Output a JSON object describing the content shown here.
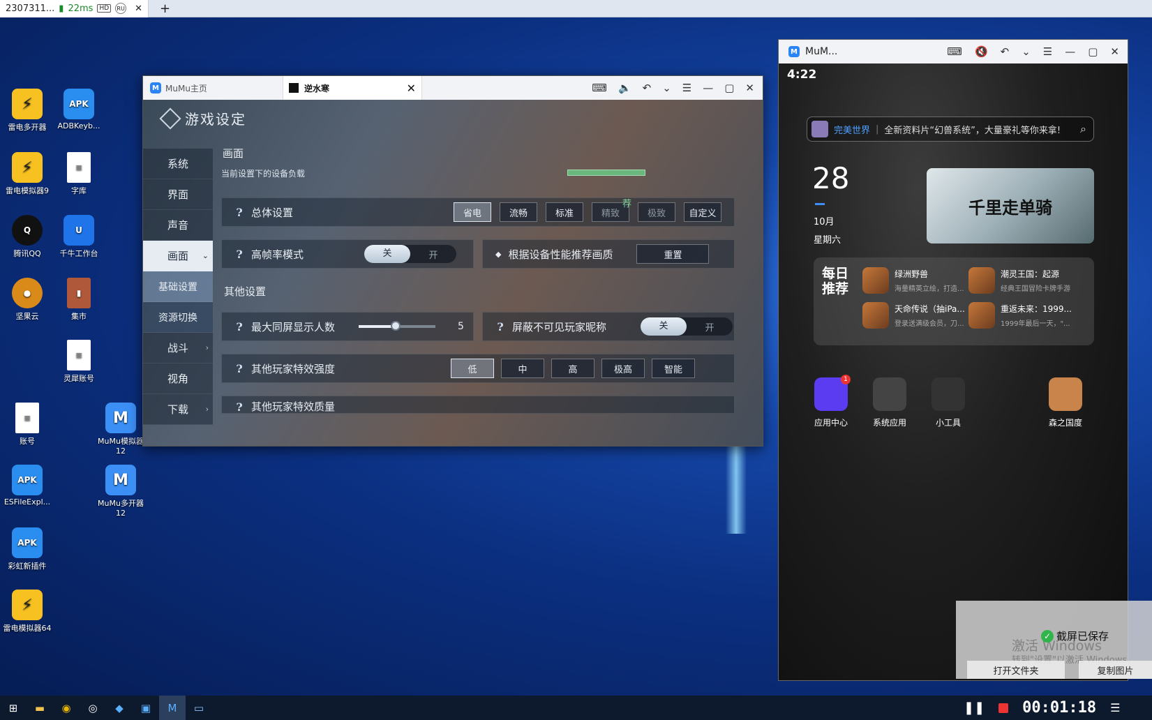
{
  "browser_bar": {
    "tab_title": "2307311...",
    "latency": "22ms",
    "hd_badge": "HD",
    "ru_badge": "RU",
    "close": "✕",
    "new_tab": "+"
  },
  "desktop_icons": [
    {
      "label": "雷电多开器",
      "glyph": "⚡",
      "kind": "ld"
    },
    {
      "label": "ADBKeyb...",
      "glyph": "APK",
      "kind": "apk"
    },
    {
      "label": "雷电模拟器9",
      "glyph": "⚡",
      "kind": "ld"
    },
    {
      "label": "字库",
      "glyph": "≡",
      "kind": "doc"
    },
    {
      "label": "腾讯QQ",
      "glyph": "Q",
      "kind": "qq"
    },
    {
      "label": "千牛工作台",
      "glyph": "U",
      "kind": "qn"
    },
    {
      "label": "坚果云",
      "glyph": "●",
      "kind": "nut"
    },
    {
      "label": "集市",
      "glyph": "▮",
      "kind": "book"
    },
    {
      "label": "灵犀账号",
      "glyph": "≡",
      "kind": "doc"
    },
    {
      "label": "账号",
      "glyph": "≡",
      "kind": "doc"
    },
    {
      "label": "MuMu模拟器12",
      "glyph": "M",
      "kind": "mm"
    },
    {
      "label": "ESFileExpl...",
      "glyph": "APK",
      "kind": "apk"
    },
    {
      "label": "MuMu多开器12",
      "glyph": "M",
      "kind": "mm"
    },
    {
      "label": "彩虹新插件",
      "glyph": "APK",
      "kind": "apk"
    },
    {
      "label": "雷电模拟器64",
      "glyph": "⚡",
      "kind": "ld"
    }
  ],
  "main_window": {
    "tab_home": "MuMu主页",
    "tab_game": "逆水寒",
    "game_title": "游戏设定",
    "sidebar": [
      "系统",
      "界面",
      "声音",
      "画面",
      "基础设置",
      "资源切换",
      "战斗",
      "视角",
      "下载"
    ],
    "section_display": "画面",
    "load_label": "当前设置下的设备负载",
    "overall_label": "总体设置",
    "overall_options": [
      "省电",
      "流畅",
      "标准",
      "精致",
      "极致",
      "自定义"
    ],
    "overall_selected": "省电",
    "recommend_badge": "荐",
    "hfr_label": "高帧率模式",
    "toggle_off": "关",
    "toggle_on": "开",
    "recommend_label": "根据设备性能推荐画质",
    "reset_btn": "重置",
    "section_other": "其他设置",
    "max_players_label": "最大同屏显示人数",
    "max_players_value": "5",
    "hide_names_label": "屏蔽不可见玩家昵称",
    "effect_strength_label": "其他玩家特效强度",
    "effect_options": [
      "低",
      "中",
      "高",
      "极高",
      "智能"
    ],
    "effect_quality_label": "其他玩家特效质量"
  },
  "phone_window": {
    "title": "MuM...",
    "time": "4:22",
    "search_brand": "完美世界",
    "search_text": "全新资料片“幻兽系统”，大量豪礼等你来拿!",
    "date_day": "28",
    "date_month": "10月",
    "date_weekday": "星期六",
    "banner_text": "千里走单骑",
    "daily_label": "每日推荐",
    "games": [
      {
        "name": "绿洲野兽",
        "desc": "海量精英立绘，打造..."
      },
      {
        "name": "潮灵王国：起源",
        "desc": "经典王国冒险卡牌手游"
      },
      {
        "name": "天命传说（抽iPa...",
        "desc": "登录送满级会员，刀..."
      },
      {
        "name": "重返未来：1999...",
        "desc": "1999年最后一天，\"..."
      }
    ],
    "apps": [
      {
        "label": "应用中心",
        "badge": "1"
      },
      {
        "label": "系统应用",
        "badge": ""
      },
      {
        "label": "小工具",
        "badge": ""
      },
      {
        "label": "森之国度",
        "badge": ""
      }
    ]
  },
  "toast": {
    "message": "截屏已保存",
    "watermark_line1": "激活 Windows",
    "watermark_line2": "转到\"设置\"以激活 Windows。",
    "open_folder": "打开文件夹",
    "copy_image": "复制图片"
  },
  "recorder": {
    "timer": "00:01:18"
  },
  "colors": {
    "accent_blue": "#2a84f5",
    "record_red": "#ee3333",
    "success_green": "#2fb54a"
  }
}
